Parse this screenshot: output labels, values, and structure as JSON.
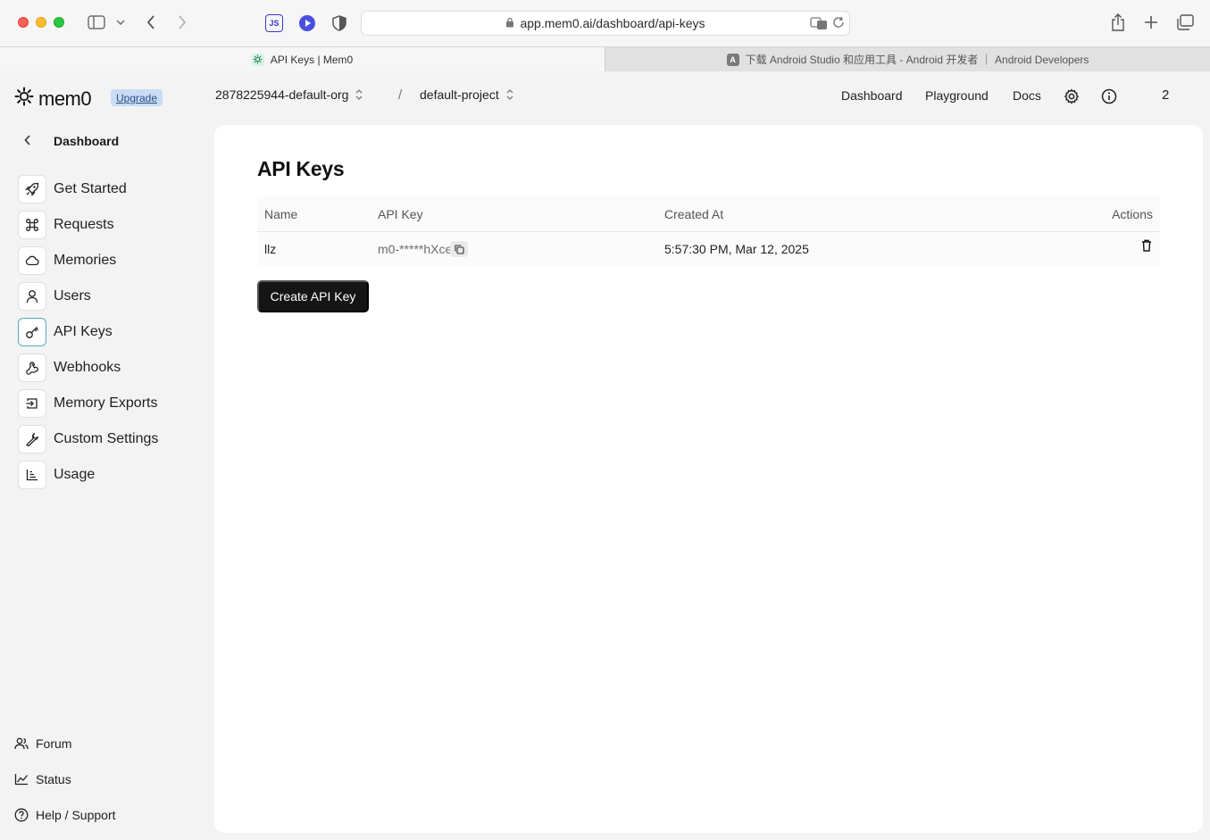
{
  "browser": {
    "url": "app.mem0.ai/dashboard/api-keys",
    "tabs": [
      {
        "title": "API Keys | Mem0",
        "favicon": "mem0-favicon"
      },
      {
        "title": "下载 Android Studio 和应用工具 - Android 开发者 ｜ Android Developers",
        "favicon_letter": "A"
      }
    ],
    "ext_js_label": "JS"
  },
  "header": {
    "logo_text": "mem0",
    "upgrade_label": "Upgrade",
    "org": "2878225944-default-org",
    "separator": "/",
    "project": "default-project",
    "nav": [
      "Dashboard",
      "Playground",
      "Docs"
    ],
    "count": "2"
  },
  "sidebar": {
    "back_label": "Dashboard",
    "items": [
      {
        "label": "Get Started",
        "icon": "rocket-icon"
      },
      {
        "label": "Requests",
        "icon": "command-icon"
      },
      {
        "label": "Memories",
        "icon": "cloud-icon"
      },
      {
        "label": "Users",
        "icon": "user-icon"
      },
      {
        "label": "API Keys",
        "icon": "key-icon",
        "active": true
      },
      {
        "label": "Webhooks",
        "icon": "webhook-icon"
      },
      {
        "label": "Memory Exports",
        "icon": "export-icon"
      },
      {
        "label": "Custom Settings",
        "icon": "wrench-icon"
      },
      {
        "label": "Usage",
        "icon": "chart-icon"
      }
    ],
    "footer": [
      {
        "label": "Forum",
        "icon": "users-icon"
      },
      {
        "label": "Status",
        "icon": "status-chart-icon"
      },
      {
        "label": "Help / Support",
        "icon": "help-icon"
      }
    ]
  },
  "main": {
    "title": "API Keys",
    "table": {
      "columns": [
        "Name",
        "API Key",
        "Created At",
        "Actions"
      ],
      "rows": [
        {
          "name": "llz",
          "api_key": "m0-*****hXce",
          "created_at": "5:57:30 PM, Mar 12, 2025"
        }
      ]
    },
    "create_button": "Create API Key"
  }
}
